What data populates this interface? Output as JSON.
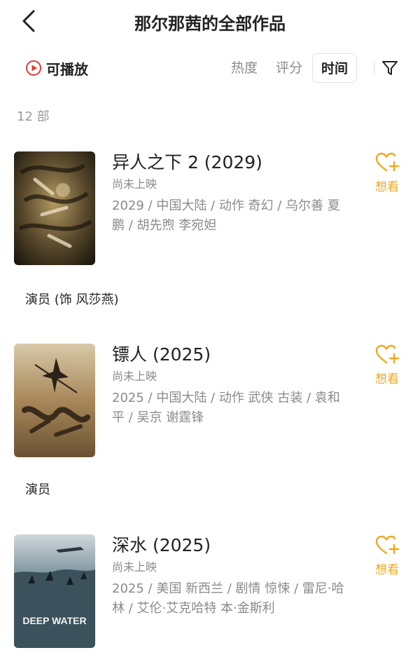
{
  "header": {
    "title": "那尔那茜的全部作品"
  },
  "filters": {
    "playable_label": "可播放",
    "sort_hot": "热度",
    "sort_score": "评分",
    "sort_time": "时间"
  },
  "count_label": "12 部",
  "items": [
    {
      "title": "异人之下 2 (2029)",
      "status": "尚未上映",
      "desc": "2029 / 中国大陆 / 动作 奇幻 / 乌尔善 夏鹏 / 胡先煦 李宛妲",
      "want_label": "想看",
      "role": "演员 (饰 风莎燕)"
    },
    {
      "title": "镖人 (2025)",
      "status": "尚未上映",
      "desc": "2025 / 中国大陆 / 动作 武侠 古装 / 袁和平 / 吴京 谢霆锋",
      "want_label": "想看",
      "role": "演员"
    },
    {
      "title": "深水 (2025)",
      "status": "尚未上映",
      "desc": "2025 / 美国 新西兰 / 剧情 惊悚 / 雷尼·哈林 / 艾伦·艾克哈特 本·金斯利",
      "want_label": "想看",
      "poster_text": "DEEP WATER"
    }
  ],
  "colors": {
    "accent": "#f0a820",
    "play_red": "#e53935",
    "muted": "#8a8a8a"
  }
}
